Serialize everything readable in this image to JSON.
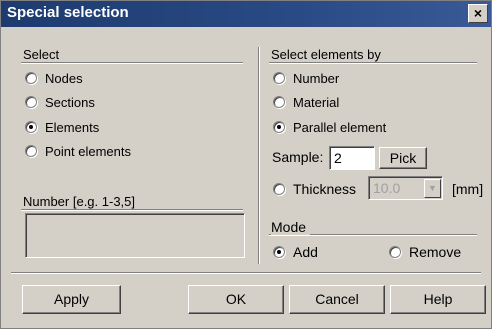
{
  "window": {
    "title": "Special selection",
    "close_label": "×"
  },
  "select_group": {
    "label": "Select",
    "options": [
      {
        "label": "Nodes",
        "checked": false
      },
      {
        "label": "Sections",
        "checked": false
      },
      {
        "label": "Elements",
        "checked": true
      },
      {
        "label": "Point elements",
        "checked": false
      }
    ]
  },
  "number_group": {
    "label": "Number [e.g. 1-3,5]",
    "value": ""
  },
  "select_by_group": {
    "label": "Select elements by",
    "options": [
      {
        "label": "Number",
        "checked": false
      },
      {
        "label": "Material",
        "checked": false
      },
      {
        "label": "Parallel element",
        "checked": true
      }
    ],
    "sample_label": "Sample:",
    "sample_value": "2",
    "pick_label": "Pick",
    "thickness_label": "Thickness",
    "thickness_checked": false,
    "thickness_value": "10.0",
    "thickness_unit": "[mm]"
  },
  "mode_group": {
    "label": "Mode",
    "add_label": "Add",
    "add_checked": true,
    "remove_label": "Remove",
    "remove_checked": false
  },
  "buttons": {
    "apply": "Apply",
    "ok": "OK",
    "cancel": "Cancel",
    "help": "Help"
  }
}
